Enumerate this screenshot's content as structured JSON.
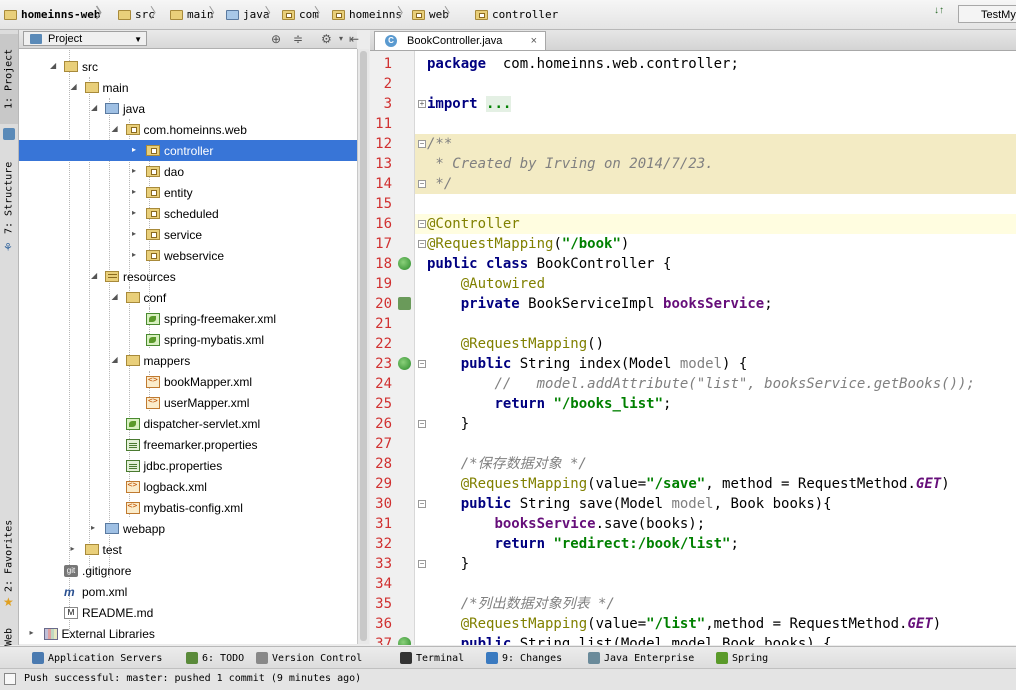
{
  "breadcrumb": [
    {
      "label": "homeinns-web",
      "icon": "module-folder-icon"
    },
    {
      "label": "src",
      "icon": "folder-icon"
    },
    {
      "label": "main",
      "icon": "folder-icon"
    },
    {
      "label": "java",
      "icon": "source-folder-icon"
    },
    {
      "label": "com",
      "icon": "package-icon"
    },
    {
      "label": "homeinns",
      "icon": "package-icon"
    },
    {
      "label": "web",
      "icon": "package-icon"
    },
    {
      "label": "controller",
      "icon": "package-icon"
    }
  ],
  "toolbar": {
    "run_config": "TestMy",
    "vcs_label": "↓↑"
  },
  "left_stripe": {
    "project": "1: Project",
    "structure": "7: Structure",
    "favorites": "2: Favorites",
    "web": "Web"
  },
  "project_panel": {
    "view_selector": "Project"
  },
  "tree": [
    {
      "label": "src",
      "depth": 2,
      "icon": "folder",
      "expanded": true
    },
    {
      "label": "main",
      "depth": 3,
      "icon": "folder",
      "expanded": true
    },
    {
      "label": "java",
      "depth": 4,
      "icon": "folder-blue",
      "expanded": true
    },
    {
      "label": "com.homeinns.web",
      "depth": 5,
      "icon": "folder-pkg",
      "expanded": true
    },
    {
      "label": "controller",
      "depth": 6,
      "icon": "folder-pkg",
      "expanded": false,
      "selected": true
    },
    {
      "label": "dao",
      "depth": 6,
      "icon": "folder-pkg",
      "expanded": false
    },
    {
      "label": "entity",
      "depth": 6,
      "icon": "folder-pkg",
      "expanded": false
    },
    {
      "label": "scheduled",
      "depth": 6,
      "icon": "folder-pkg",
      "expanded": false
    },
    {
      "label": "service",
      "depth": 6,
      "icon": "folder-pkg",
      "expanded": false
    },
    {
      "label": "webservice",
      "depth": 6,
      "icon": "folder-pkg",
      "expanded": false
    },
    {
      "label": "resources",
      "depth": 4,
      "icon": "folder-res",
      "expanded": true
    },
    {
      "label": "conf",
      "depth": 5,
      "icon": "folder",
      "expanded": true
    },
    {
      "label": "spring-freemaker.xml",
      "depth": 6,
      "icon": "spring"
    },
    {
      "label": "spring-mybatis.xml",
      "depth": 6,
      "icon": "spring"
    },
    {
      "label": "mappers",
      "depth": 5,
      "icon": "folder",
      "expanded": true
    },
    {
      "label": "bookMapper.xml",
      "depth": 6,
      "icon": "xml"
    },
    {
      "label": "userMapper.xml",
      "depth": 6,
      "icon": "xml"
    },
    {
      "label": "dispatcher-servlet.xml",
      "depth": 5,
      "icon": "spring"
    },
    {
      "label": "freemarker.properties",
      "depth": 5,
      "icon": "props"
    },
    {
      "label": "jdbc.properties",
      "depth": 5,
      "icon": "props"
    },
    {
      "label": "logback.xml",
      "depth": 5,
      "icon": "xml"
    },
    {
      "label": "mybatis-config.xml",
      "depth": 5,
      "icon": "xml"
    },
    {
      "label": "webapp",
      "depth": 4,
      "icon": "folder-blue",
      "expanded": false
    },
    {
      "label": "test",
      "depth": 3,
      "icon": "folder",
      "expanded": false
    },
    {
      "label": ".gitignore",
      "depth": 2,
      "icon": "git"
    },
    {
      "label": "pom.xml",
      "depth": 2,
      "icon": "maven"
    },
    {
      "label": "README.md",
      "depth": 2,
      "icon": "md"
    },
    {
      "label": "External Libraries",
      "depth": 1,
      "icon": "lib",
      "expanded": false
    }
  ],
  "editor": {
    "tab_label": "BookController.java",
    "lines": [
      {
        "n": "1",
        "tokens": [
          [
            "kw",
            "package"
          ],
          [
            "",
            "  com.homeinns.web.controller;"
          ]
        ]
      },
      {
        "n": "2",
        "tokens": []
      },
      {
        "n": "3",
        "tokens": [
          [
            "kw",
            "import"
          ],
          [
            "",
            " "
          ],
          [
            "fold-dots",
            "..."
          ]
        ],
        "fold": "plus"
      },
      {
        "n": "11",
        "tokens": []
      },
      {
        "n": "12",
        "tokens": [
          [
            "cm",
            "/**"
          ]
        ],
        "hl": "comment",
        "fold": "minus"
      },
      {
        "n": "13",
        "tokens": [
          [
            "cm",
            " * Created by Irving on 2014/7/23."
          ]
        ],
        "hl": "comment"
      },
      {
        "n": "14",
        "tokens": [
          [
            "cm",
            " */"
          ]
        ],
        "hl": "comment",
        "fold": "minus"
      },
      {
        "n": "15",
        "tokens": []
      },
      {
        "n": "16",
        "tokens": [
          [
            "ann",
            "@Controller"
          ]
        ],
        "hl": "caret",
        "fold": "minus"
      },
      {
        "n": "17",
        "tokens": [
          [
            "ann",
            "@RequestMapping"
          ],
          [
            "",
            "("
          ],
          [
            "str",
            "\"/book\""
          ],
          [
            "",
            ")"
          ]
        ],
        "fold": "minus"
      },
      {
        "n": "18",
        "tokens": [
          [
            "kw",
            "public class"
          ],
          [
            "",
            " BookController {"
          ]
        ],
        "gicon": "g1"
      },
      {
        "n": "19",
        "tokens": [
          [
            "",
            "    "
          ],
          [
            "ann",
            "@Autowired"
          ]
        ]
      },
      {
        "n": "20",
        "tokens": [
          [
            "",
            "    "
          ],
          [
            "kw",
            "private"
          ],
          [
            "",
            " BookServiceImpl "
          ],
          [
            "fld",
            "booksService"
          ],
          [
            "",
            ";"
          ]
        ],
        "gicon": "g2"
      },
      {
        "n": "21",
        "tokens": []
      },
      {
        "n": "22",
        "tokens": [
          [
            "",
            "    "
          ],
          [
            "ann",
            "@RequestMapping"
          ],
          [
            "",
            "()"
          ]
        ]
      },
      {
        "n": "23",
        "tokens": [
          [
            "",
            "    "
          ],
          [
            "kw",
            "public"
          ],
          [
            "",
            " String index(Model "
          ],
          [
            "prm",
            "model"
          ],
          [
            "",
            ") {"
          ]
        ],
        "gicon": "g1",
        "fold": "minus"
      },
      {
        "n": "24",
        "tokens": [
          [
            "",
            "        "
          ],
          [
            "cm",
            "//   model.addAttribute(\"list\", booksService.getBooks());"
          ]
        ]
      },
      {
        "n": "25",
        "tokens": [
          [
            "",
            "        "
          ],
          [
            "kw",
            "return"
          ],
          [
            "",
            " "
          ],
          [
            "str",
            "\"/books_list\""
          ],
          [
            "",
            ";"
          ]
        ]
      },
      {
        "n": "26",
        "tokens": [
          [
            "",
            "    }"
          ]
        ],
        "fold": "minus"
      },
      {
        "n": "27",
        "tokens": []
      },
      {
        "n": "28",
        "tokens": [
          [
            "",
            "    "
          ],
          [
            "cm",
            "/*保存数据对象 */"
          ]
        ]
      },
      {
        "n": "29",
        "tokens": [
          [
            "",
            "    "
          ],
          [
            "ann",
            "@RequestMapping"
          ],
          [
            "",
            "(value="
          ],
          [
            "str",
            "\"/save\""
          ],
          [
            "",
            ", method = RequestMethod."
          ],
          [
            "cst",
            "GET"
          ],
          [
            "",
            ")"
          ]
        ]
      },
      {
        "n": "30",
        "tokens": [
          [
            "",
            "    "
          ],
          [
            "kw",
            "public"
          ],
          [
            "",
            " String save(Model "
          ],
          [
            "prm",
            "model"
          ],
          [
            "",
            ", Book books){"
          ]
        ],
        "fold": "minus"
      },
      {
        "n": "31",
        "tokens": [
          [
            "",
            "        "
          ],
          [
            "fld",
            "booksService"
          ],
          [
            "",
            ".save(books);"
          ]
        ]
      },
      {
        "n": "32",
        "tokens": [
          [
            "",
            "        "
          ],
          [
            "kw",
            "return"
          ],
          [
            "",
            " "
          ],
          [
            "str",
            "\"redirect:/book/list\""
          ],
          [
            "",
            ";"
          ]
        ]
      },
      {
        "n": "33",
        "tokens": [
          [
            "",
            "    }"
          ]
        ],
        "fold": "minus"
      },
      {
        "n": "34",
        "tokens": []
      },
      {
        "n": "35",
        "tokens": [
          [
            "",
            "    "
          ],
          [
            "cm",
            "/*列出数据对象列表 */"
          ]
        ]
      },
      {
        "n": "36",
        "tokens": [
          [
            "",
            "    "
          ],
          [
            "ann",
            "@RequestMapping"
          ],
          [
            "",
            "(value="
          ],
          [
            "str",
            "\"/list\""
          ],
          [
            "",
            ",method = RequestMethod."
          ],
          [
            "cst",
            "GET"
          ],
          [
            "",
            ")"
          ]
        ]
      },
      {
        "n": "37",
        "tokens": [
          [
            "",
            "    "
          ],
          [
            "kw",
            "public"
          ],
          [
            "",
            " String list(Model model,Book books) {"
          ]
        ],
        "gicon": "g1"
      }
    ]
  },
  "tool_windows": [
    {
      "label": "Application Servers",
      "mnemonic": "",
      "color": "#4a7ab0"
    },
    {
      "label": "6: TODO",
      "mnemonic": "6",
      "color": "#5a8a3a"
    },
    {
      "label": "Version Control",
      "mnemonic": "",
      "color": "#888888"
    },
    {
      "label": "Terminal",
      "mnemonic": "",
      "color": "#333333"
    },
    {
      "label": "9: Changes",
      "mnemonic": "9",
      "color": "#3a7ac0"
    },
    {
      "label": "Java Enterprise",
      "mnemonic": "",
      "color": "#6a8a9a"
    },
    {
      "label": "Spring",
      "mnemonic": "",
      "color": "#5a9a2a"
    }
  ],
  "status": {
    "message": "Push successful: master: pushed 1 commit (9 minutes ago)"
  }
}
